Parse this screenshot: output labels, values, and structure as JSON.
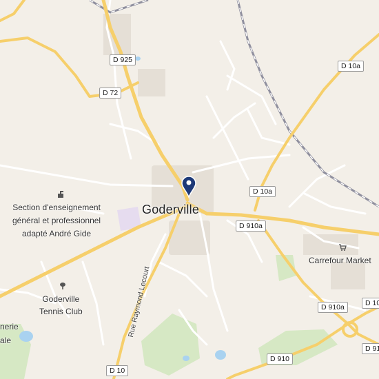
{
  "map": {
    "town": "Goderville",
    "pois": {
      "school": [
        "Section d'enseignement",
        "général et professionnel",
        "adapté André Gide"
      ],
      "tennis": [
        "Goderville",
        "Tennis Club"
      ],
      "carrefour": "Carrefour Market",
      "partial_left": [
        "nerie",
        "ale"
      ]
    },
    "roads": {
      "d925": "D 925",
      "d72": "D 72",
      "d10a_top": "D 10a",
      "d10a_mid": "D 10a",
      "d910a_mid": "D 910a",
      "d910a_low": "D 910a",
      "d910": "D 910",
      "d10": "D 10",
      "d10_right": "D 10",
      "d91_right": "D 91"
    },
    "street": "Rue Raymond Lecourt",
    "colors": {
      "background": "#f3efe8",
      "major_road": "#f6cf6b",
      "minor_road": "#ffffff",
      "building": "#e3ddd4",
      "green": "#d6e8c4",
      "water": "#a9d2f0",
      "rail": "#8f8f9e",
      "pin": "#1e3a78"
    },
    "icons": [
      "location-pin-icon",
      "school-icon",
      "tennis-icon",
      "cart-icon"
    ]
  }
}
